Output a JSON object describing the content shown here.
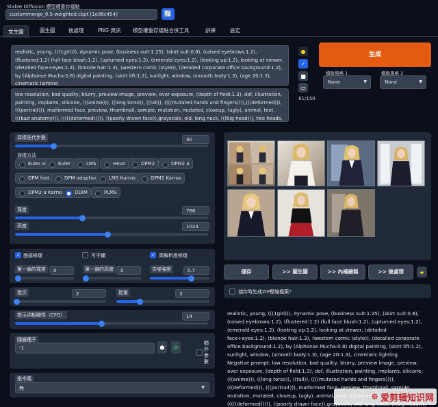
{
  "checkpoint": {
    "label": "Stable Diffusion 模型權重存檔點",
    "value": "custommerge_0.5-weighted.ckpt [1e98c454]"
  },
  "tabs": [
    "文生圖",
    "圖生圖",
    "後處理",
    "PNG 資訊",
    "模型權重存檔點合併工具",
    "訓練",
    "設定"
  ],
  "prompt": "realistic, young, (((1girl))), dynamic pose, (business suit:1.25), (skirt suit:0.8), (raised eyebrows:1.2), (flustered:1.2) (full face blush:1.2), (upturned eyes:1.2), (emerald eyes:1.2), (looking up:1.2), looking at viewer, (detailed face+eyes:1.2), (blonde hair:1.3), (western comic (style)), (detailed corporate office background:1.2), by (Alphonse Mucha:0.8) digital painting, (skirt lift:1.2), sunlight, window, (smooth body:1.3), (age 20:1.3), cinematic lighting",
  "negative_prompt": "low resolution, bad quality, blurry, preview image, preview, over exposure, (depth of field:1.3), dof, illustration, painting, implants, silicone, (((anime))), ((long torso)), ((tall)), ((((mutated hands and fingers)))),(((deformed))), (((portrait))), malformed face, preview, thumbnail, sample, mutation, mutated, closeup, (ugly), animal, text, (((bad anatomy))), (((((deformed))))), ((poorly drawn face)),grayscale, old, long neck, (((big head))), two heads, (((boy))), (((amputated))), (((big eyes)))",
  "token_count": "81/150",
  "generate_label": "生成",
  "style1": {
    "label": "模版風格 1",
    "value": "None"
  },
  "style2": {
    "label": "模版風格 2",
    "value": "None"
  },
  "steps": {
    "label": "採樣迭代步數",
    "value": "30",
    "fraction": 0.2
  },
  "sampler": {
    "label": "採樣方法",
    "options": [
      "Euler a",
      "Euler",
      "LMS",
      "Heun",
      "DPM2",
      "DPM2 a",
      "DPM fast",
      "DPM adaptive",
      "LMS Karras",
      "DPM2 Karras",
      "DPM2 a Karras",
      "DDIM",
      "PLMS"
    ],
    "selected": "DDIM"
  },
  "width": {
    "label": "寬度",
    "value": "768",
    "fraction": 0.35
  },
  "height": {
    "label": "高度",
    "value": "1024",
    "fraction": 0.48
  },
  "checks": {
    "face_restore": "面部修復",
    "tiling": "可平鋪",
    "hires_fix": "高解析度修復"
  },
  "first_pass_width": {
    "label": "第一遍的寬度",
    "value": "0"
  },
  "first_pass_height": {
    "label": "第一遍的高度",
    "value": "0"
  },
  "denoise": {
    "label": "去噪強度",
    "value": "0.7",
    "fraction": 0.7
  },
  "batch_count": {
    "label": "批次",
    "value": "2",
    "fraction": 0.02
  },
  "batch_size": {
    "label": "批量",
    "value": "3",
    "fraction": 0.25
  },
  "cfg": {
    "label": "提示詞相關性（CFG）",
    "value": "14",
    "fraction": 0.45
  },
  "seed": {
    "label": "隨機種子",
    "value": "-1"
  },
  "extra": {
    "label": "額外參數"
  },
  "script": {
    "label": "指令碼",
    "value": "無"
  },
  "actions": {
    "save": "儲存",
    "to_img2img": ">> 圖生圖",
    "to_inpaint": ">> 內補繪製",
    "to_extras": ">> 後處理"
  },
  "zip_label": "儲存時生成ZIP壓縮檔案?",
  "output_text": "realistic, young, (((1girl))), dynamic pose, (business suit:1.25), (skirt suit:0.8), (raised eyebrows:1.2), (flustered:1.2) (full face blush:1.2), (upturned eyes:1.2), (emerald eyes:1.2), (looking up:1.2), looking at viewer, (detailed face+eyes:1.2), (blonde hair:1.3), (western comic (style)), (detailed corporate office background:1.2), by (Alphonse Mucha:0.8) digital painting, (skirt lift:1.2), sunlight, window, (smooth body:1.3), (age 20:1.3), cinematic lighting\nNegative prompt: low resolution, bad quality, blurry, preview image, preview, over exposure, (depth of field:1.3), dof, illustration, painting, implants, silicone, (((anime))), ((long torso)), ((tall)), ((((mutated hands and fingers)))),(((deformed))), (((portrait))), malformed face, preview, thumbnail, sample, mutation, mutated, closeup, (ugly), animal, text, (((bad anatomy))), (((((deformed))))), ((poorly drawn face)),grayscale, old, long neck, (((big head))), two heads, (((boy))), (((amputated))), (((big eyes)))",
  "watermark": "爱剪辑知识网",
  "colors": {
    "accent": "#2563eb",
    "generate": "#e25b10",
    "bg": "#0b0f19",
    "panel": "#1f2937"
  }
}
